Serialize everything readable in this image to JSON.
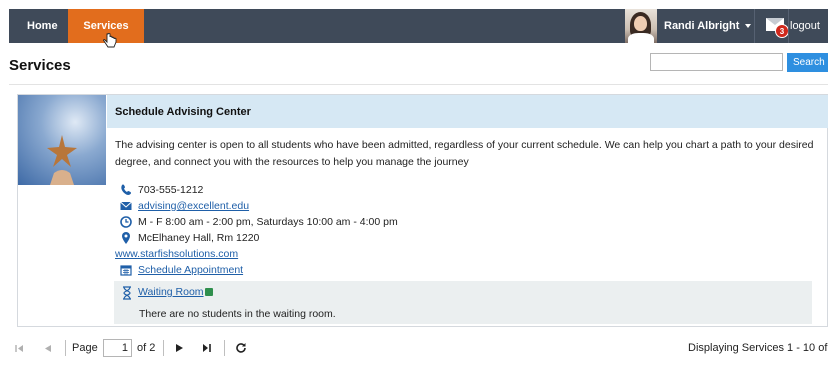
{
  "nav": {
    "home_label": "Home",
    "services_label": "Services",
    "active": "Services"
  },
  "user": {
    "name": "Randi Albright",
    "message_count": "3",
    "logout_label": "logout"
  },
  "page": {
    "title": "Services",
    "search_placeholder": "",
    "search_button": "Search"
  },
  "service": {
    "title": "Schedule Advising Center",
    "description": "The advising center is open to all students who have been admitted, regardless of your current schedule. We can help you chart a path to your desired degree, and connect you with the resources to help you manage the journey",
    "phone": "703-555-1212",
    "email": "advising@excellent.edu",
    "hours": "M - F 8:00 am - 2:00 pm, Saturdays 10:00 am - 4:00 pm",
    "location": "McElhaney Hall, Rm 1220",
    "website": "www.starfishsolutions.com",
    "schedule_link": "Schedule Appointment",
    "waiting_room": {
      "label": "Waiting Room",
      "message": "There are no students in the waiting room."
    }
  },
  "pager": {
    "page_label": "Page",
    "current_page": "1",
    "of_label": "of 2",
    "display_text": "Displaying Services 1 - 10 of 1"
  },
  "colors": {
    "nav_bg": "#3f4a59",
    "active_tab": "#e26d1d",
    "card_header": "#d6e8f4",
    "link": "#1f5fa8",
    "search_button": "#2e8fe0",
    "badge": "#d0281c"
  }
}
